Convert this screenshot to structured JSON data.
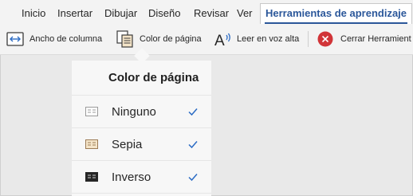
{
  "tabs": [
    {
      "label": "Inicio"
    },
    {
      "label": "Insertar"
    },
    {
      "label": "Dibujar"
    },
    {
      "label": "Diseño"
    },
    {
      "label": "Revisar"
    },
    {
      "label": "Ver"
    },
    {
      "label": "Herramientas de aprendizaje",
      "active": true
    }
  ],
  "ribbon": {
    "column_width": {
      "label": "Ancho de columna",
      "icon": "column-width-icon"
    },
    "page_color": {
      "label": "Color de página",
      "icon": "page-color-icon"
    },
    "read_aloud": {
      "label": "Leer en voz alta",
      "icon": "read-aloud-icon"
    },
    "close_tools": {
      "label": "Cerrar Herramient",
      "icon": "close-icon",
      "color": "#d13438"
    }
  },
  "dropdown": {
    "title": "Color de página",
    "options": [
      {
        "label": "Ninguno",
        "swatch": "#ffffff",
        "checked": true
      },
      {
        "label": "Sepia",
        "swatch": "#f4e4c8",
        "checked": true
      },
      {
        "label": "Inverso",
        "swatch": "#262626",
        "checked": true
      }
    ]
  },
  "colors": {
    "accent": "#2b579a",
    "check": "#2b6bc4",
    "background": "#e9e9e9"
  }
}
